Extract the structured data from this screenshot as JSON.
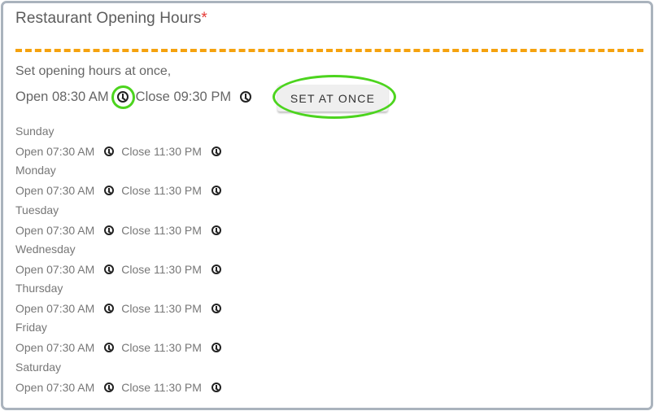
{
  "header": {
    "title": "Restaurant Opening Hours",
    "required_mark": "*"
  },
  "bulk": {
    "intro": "Set opening hours at once,",
    "open_text": "Open 08:30 AM",
    "close_text": "Close 09:30 PM",
    "button_label": "SET AT ONCE"
  },
  "days": [
    {
      "name": "Sunday",
      "open": "Open 07:30 AM",
      "close": "Close 11:30 PM"
    },
    {
      "name": "Monday",
      "open": "Open 07:30 AM",
      "close": "Close 11:30 PM"
    },
    {
      "name": "Tuesday",
      "open": "Open 07:30 AM",
      "close": "Close 11:30 PM"
    },
    {
      "name": "Wednesday",
      "open": "Open 07:30 AM",
      "close": "Close 11:30 PM"
    },
    {
      "name": "Thursday",
      "open": "Open 07:30 AM",
      "close": "Close 11:30 PM"
    },
    {
      "name": "Friday",
      "open": "Open 07:30 AM",
      "close": "Close 11:30 PM"
    },
    {
      "name": "Saturday",
      "open": "Open 07:30 AM",
      "close": "Close 11:30 PM"
    }
  ],
  "icons": {
    "clock": "clock-icon"
  },
  "colors": {
    "accent_divider": "#f5a20e",
    "required": "#e53935",
    "highlight": "#4cd41e",
    "border": "#aab3bd"
  }
}
